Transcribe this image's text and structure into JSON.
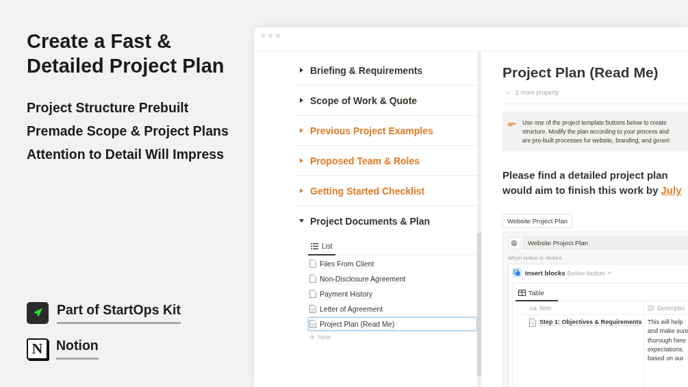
{
  "headline": [
    "Create a Fast &",
    "Detailed Project Plan"
  ],
  "features": [
    "Project Structure Prebuilt",
    "Premade Scope & Project Plans",
    "Attention to Detail Will Impress"
  ],
  "badges": [
    {
      "kind": "startops",
      "label": "Part of StartOps Kit"
    },
    {
      "kind": "notion",
      "label": "Notion",
      "logo_letter": "N"
    }
  ],
  "sidebar": {
    "toggles": [
      {
        "label": "Briefing & Requirements",
        "expanded": false,
        "color": "#37352f"
      },
      {
        "label": "Scope of Work & Quote",
        "expanded": false,
        "color": "#37352f"
      },
      {
        "label": "Previous Project Examples",
        "expanded": false,
        "color": "#e07b27"
      },
      {
        "label": "Proposed Team & Roles",
        "expanded": false,
        "color": "#e07b27"
      },
      {
        "label": "Getting Started Checklist",
        "expanded": false,
        "color": "#e07b27"
      },
      {
        "label": "Project Documents & Plan",
        "expanded": true,
        "color": "#37352f"
      }
    ],
    "view_tab": "List",
    "items": [
      {
        "label": "Files From Client",
        "kind": "page",
        "selected": false
      },
      {
        "label": "Non-Disclosure Agreement",
        "kind": "page",
        "selected": false
      },
      {
        "label": "Payment History",
        "kind": "page",
        "selected": false
      },
      {
        "label": "Letter of Agreement",
        "kind": "doc",
        "selected": false
      },
      {
        "label": "Project Plan (Read Me)",
        "kind": "doc",
        "selected": true
      }
    ],
    "new_label": "New"
  },
  "page": {
    "title": "Project Plan (Read Me)",
    "property_toggle": "1 more property",
    "callout": [
      "Use one of the project template buttons below to create",
      "structure. Modify the plan according to your process and",
      "are pre-built processes for website, branding, and generi"
    ],
    "heading": [
      "Please find a detailed project plan",
      {
        "text": "would aim to finish this work by",
        "link": "July"
      }
    ],
    "template_button": "Website Project Plan",
    "editor": {
      "button_name": "Website Project Plan",
      "trigger": "When button is clicked",
      "action": "Insert blocks",
      "position": "Below button",
      "table_tab": "Table",
      "columns": [
        {
          "prefix": "Aa",
          "label": "Item"
        },
        {
          "label": "Descriptio"
        }
      ],
      "row": {
        "item": "Step 1: Objectives & Requirements",
        "description": [
          "This will help",
          "and make sure",
          "thorough here",
          "expectations.",
          "based on our"
        ]
      }
    }
  }
}
